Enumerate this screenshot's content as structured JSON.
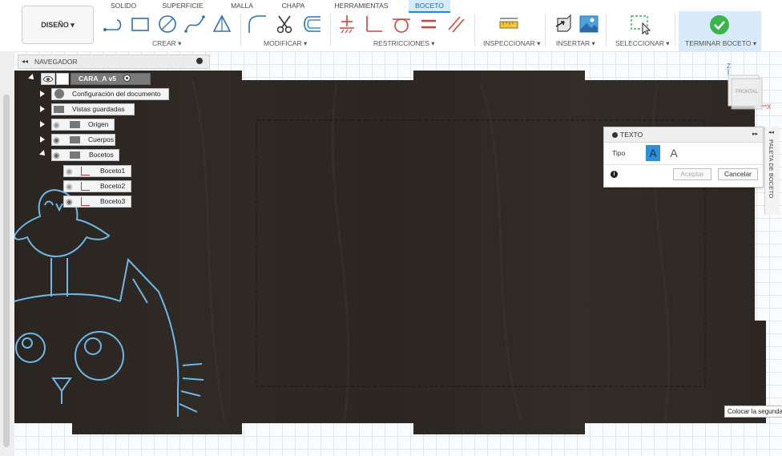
{
  "ribbon": {
    "design_button": "DISEÑO ▾",
    "tabs": [
      "SOLIDO",
      "SUPERFICIE",
      "MALLA",
      "CHAPA",
      "HERRAMIENTAS",
      "BOCETO"
    ],
    "active_tab": "BOCETO",
    "groups": {
      "create": "CREAR ▾",
      "modify": "MODIFICAR ▾",
      "constraints": "RESTRICCIONES ▾",
      "inspect": "INSPECCIONAR ▾",
      "insert": "INSERTAR ▾",
      "select": "SELECCIONAR ▾",
      "finish": "TERMINAR BOCETO ▾"
    },
    "colors": {
      "accent": "#1a8be0",
      "tool_stroke": "#2b73b7",
      "constraint_red": "#d0453a",
      "finish_green": "#3ab54a"
    }
  },
  "navigator": {
    "title": "NAVEGADOR",
    "root": "CARA_A v5",
    "items": [
      {
        "label": "Configuración del documento",
        "icon": "gear-icon"
      },
      {
        "label": "Vistas guardadas",
        "icon": "folder-icon"
      },
      {
        "label": "Origen",
        "icon": "folder-icon"
      },
      {
        "label": "Cuerpos",
        "icon": "folder-icon"
      },
      {
        "label": "Bocetos",
        "icon": "folder-icon"
      }
    ],
    "sketches": [
      "Boceto1",
      "Boceto2",
      "Boceto3"
    ]
  },
  "viewcube": {
    "face": "FRONTAL",
    "axis_z": "Z",
    "axis_x": "X"
  },
  "text_dialog": {
    "title": "TEXTO",
    "type_label": "Tipo",
    "accept": "Aceptar",
    "cancel": "Cancelar"
  },
  "sketch_palette": {
    "label": "PALETA DE BOCETO"
  },
  "tooltip": "Colocar la segunda"
}
